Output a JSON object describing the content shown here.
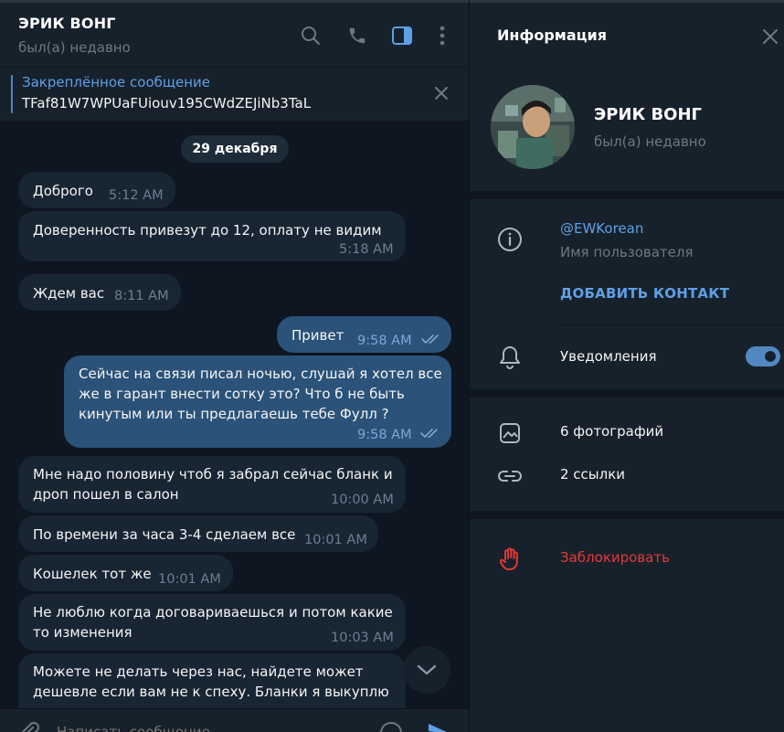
{
  "colors": {
    "background": "#0e1621",
    "panel": "#17212b",
    "incoming_bubble": "#182533",
    "outgoing_bubble": "#2b5278",
    "accent": "#5ea0e5",
    "danger": "#e53935"
  },
  "chat": {
    "title": "ЭРИК ВОНГ",
    "status": "был(а) недавно",
    "header_icons": [
      "search-icon",
      "phone-icon",
      "sidebar-toggle-icon",
      "more-vertical-icon"
    ],
    "pinned": {
      "title": "Закреплённое сообщение",
      "text": "TFaf81W7WPUaFUiouv195CWdZEJiNb3TaL"
    },
    "date": "29 декабря",
    "messages": [
      {
        "dir": "in",
        "text": "Доброго",
        "time": "5:12 AM"
      },
      {
        "dir": "in",
        "text": "Доверенность привезут до 12, оплату не видим",
        "time": "5:18 AM"
      },
      {
        "dir": "in",
        "text": "Ждем вас",
        "time": "8:11 AM"
      },
      {
        "dir": "out",
        "text": "Привет",
        "time": "9:58 AM",
        "read": true
      },
      {
        "dir": "out",
        "lines": [
          "Сейчас на связи писал ночью, слушай я хотел все",
          "же в гарант внести сотку это? Что б не быть",
          "кинутым или ты предлагаешь тебе Фулл ?"
        ],
        "time": "9:58 AM",
        "read": true
      },
      {
        "dir": "in",
        "lines": [
          "Мне надо половину чтоб я забрал сейчас бланк и",
          "дроп пошел в салон"
        ],
        "time": "10:00 AM"
      },
      {
        "dir": "in",
        "text": "По времени за часа 3-4 сделаем все",
        "time": "10:01 AM"
      },
      {
        "dir": "in",
        "text": "Кошелек тот же",
        "time": "10:01 AM"
      },
      {
        "dir": "in",
        "lines": [
          "Не люблю когда договариваешься и потом какие",
          "то изменения"
        ],
        "time": "10:03 AM"
      },
      {
        "dir": "in",
        "lines": [
          "Можете не делать через нас, найдете может",
          "дешевле если вам не к спеху. Бланки я выкуплю"
        ]
      }
    ],
    "composer_placeholder": "Написать сообщение..."
  },
  "info": {
    "title": "Информация",
    "name": "ЭРИК ВОНГ",
    "status": "был(а) недавно",
    "username": "@EWKorean",
    "username_caption": "Имя пользователя",
    "add_contact": "ДОБАВИТЬ КОНТАКТ",
    "notifications_label": "Уведомления",
    "notifications_on": true,
    "photos": "6 фотографий",
    "links": "2 ссылки",
    "block": "Заблокировать"
  }
}
